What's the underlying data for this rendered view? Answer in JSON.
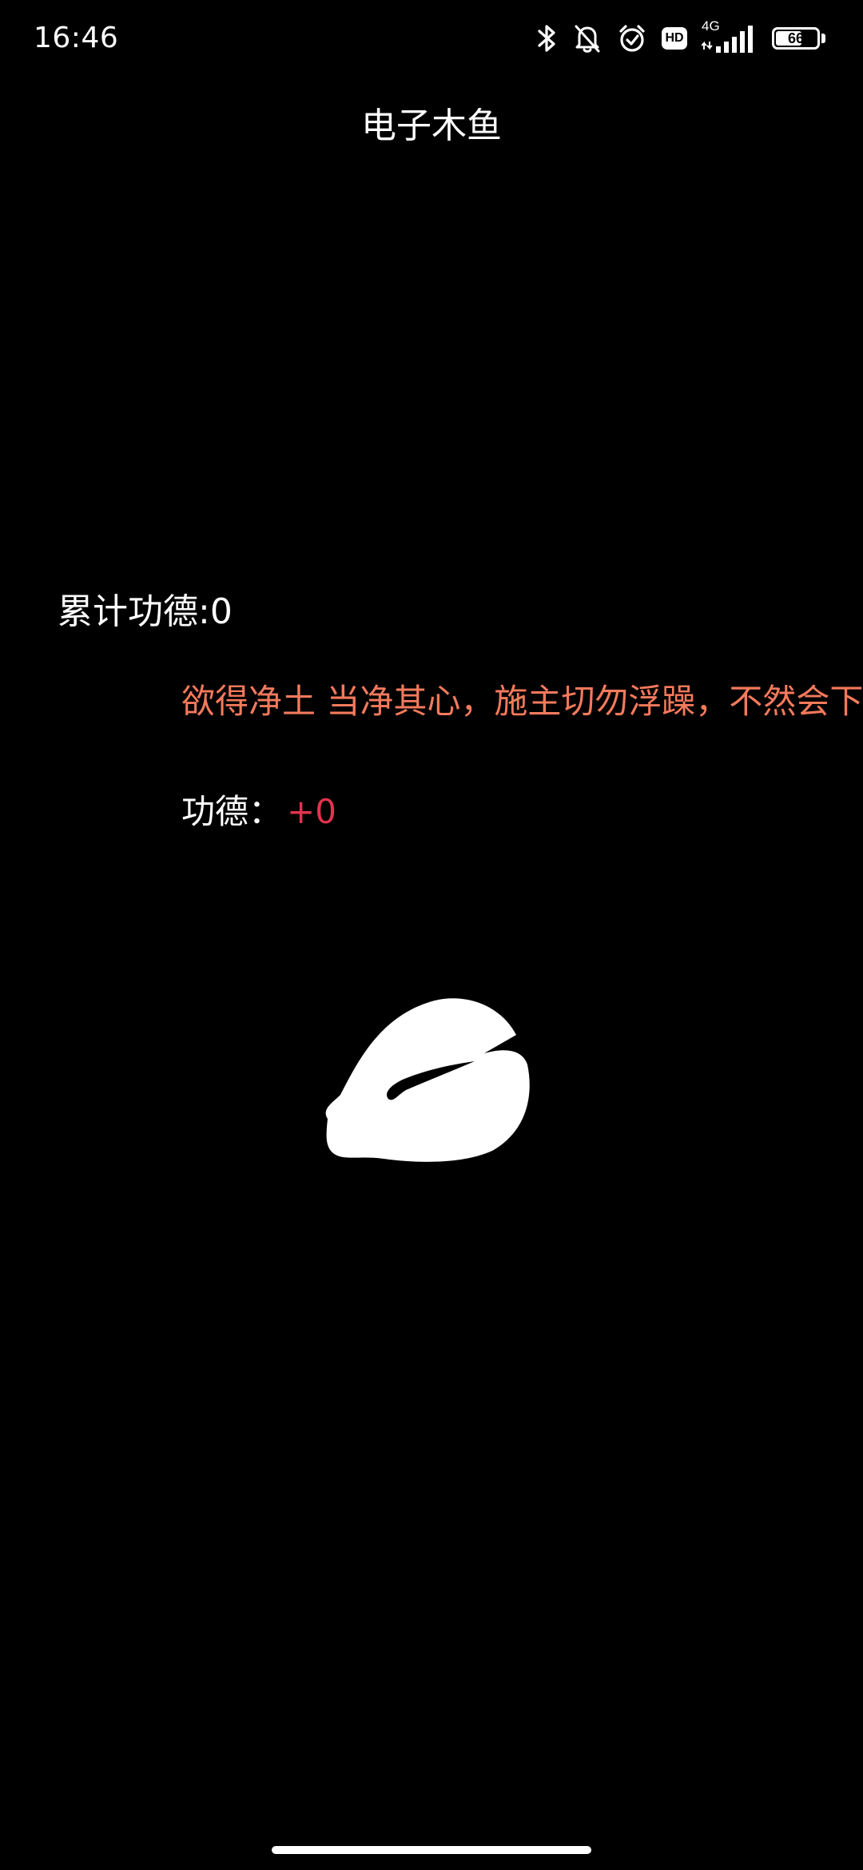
{
  "status_bar": {
    "time": "16:46",
    "network": "4G",
    "hd": "HD",
    "battery": 66,
    "battery_label": "66",
    "icons": [
      "bluetooth-icon",
      "bell-off-icon",
      "alarm-icon",
      "hd-icon",
      "signal-icon",
      "battery-icon"
    ]
  },
  "app": {
    "title": "电子木鱼",
    "total_merit_label": "累计功德:0",
    "marquee_text": "欲得净土 当净其心，施主切勿浮躁，不然会下",
    "merit_label": "功德：",
    "merit_value": "+0",
    "woodfish_icon": "wooden-fish-icon"
  },
  "colors": {
    "background": "#000000",
    "text": "#ffffff",
    "marquee": "#f57a5c",
    "merit_value": "#e0344e"
  }
}
